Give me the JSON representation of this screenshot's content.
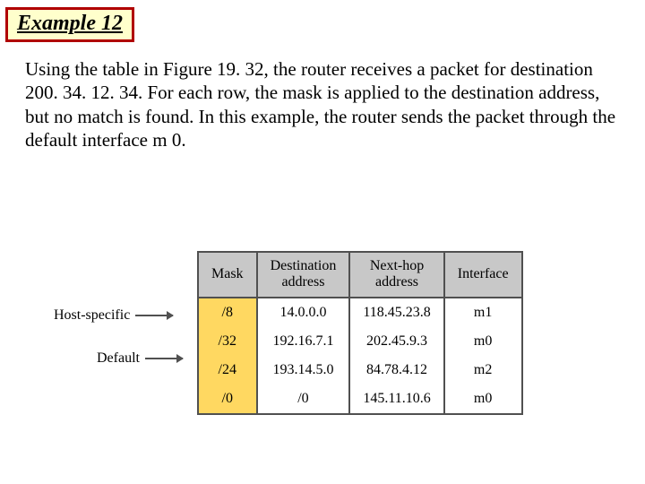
{
  "title": "Example 12",
  "paragraph": "Using the table in Figure 19. 32, the router receives a packet for destination 200. 34. 12. 34. For each row, the mask is applied to the destination address, but no match is found. In this example, the router sends the packet through the default interface m 0.",
  "labels": {
    "host_specific": "Host-specific",
    "default": "Default"
  },
  "table": {
    "headers": {
      "mask": "Mask",
      "dest": "Destination\naddress",
      "nexthop": "Next-hop\naddress",
      "iface": "Interface"
    },
    "rows": [
      {
        "mask": "/8",
        "dest": "14.0.0.0",
        "nexthop": "118.45.23.8",
        "iface": "m1"
      },
      {
        "mask": "/32",
        "dest": "192.16.7.1",
        "nexthop": "202.45.9.3",
        "iface": "m0"
      },
      {
        "mask": "/24",
        "dest": "193.14.5.0",
        "nexthop": "84.78.4.12",
        "iface": "m2"
      },
      {
        "mask": "/0",
        "dest": "/0",
        "nexthop": "145.11.10.6",
        "iface": "m0"
      }
    ]
  }
}
